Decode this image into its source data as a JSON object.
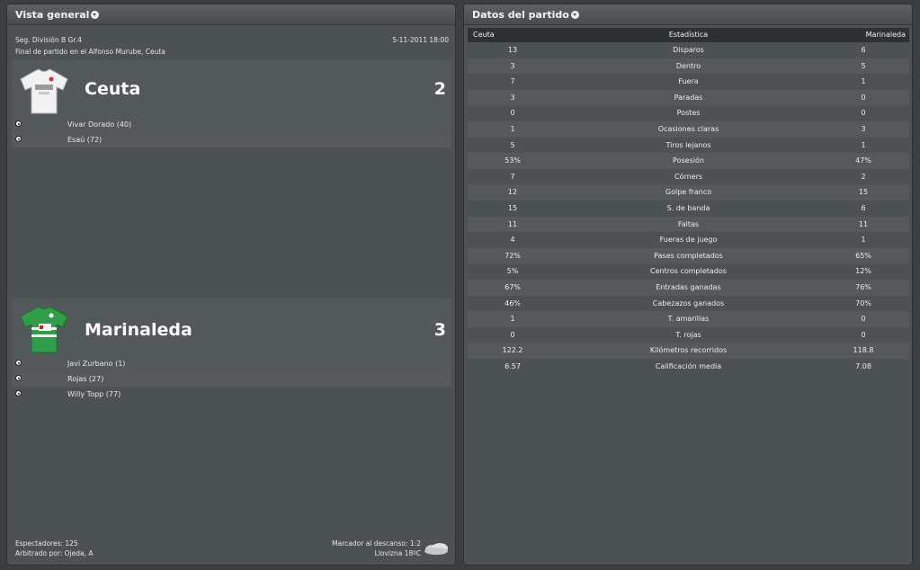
{
  "overview": {
    "title": "Vista general",
    "competition": "Seg. División B Gr.4",
    "date": "5-11-2011 18:00",
    "venue_line": "Final de partido en el Alfonso Murube, Ceuta",
    "home": {
      "name": "Ceuta",
      "score": "2",
      "kit_icon": "white-shirt-icon",
      "scorers": [
        "Vivar Dorado (40)",
        "Esaú (72)"
      ]
    },
    "away": {
      "name": "Marinaleda",
      "score": "3",
      "kit_icon": "green-shirt-icon",
      "scorers": [
        "Javi Zurbano (1)",
        "Rojas (27)",
        "Willy Topp (77)"
      ]
    },
    "attendance": "Espectadores: 125",
    "referee": "Arbitrado por: Ojeda, A",
    "halftime": "Marcador al descanso: 1:2",
    "weather": "Llovizna 18ºC",
    "weather_icon": "cloud-rain-icon"
  },
  "stats": {
    "title": "Datos del partido",
    "header": {
      "home": "Ceuta",
      "stat": "Estadística",
      "away": "Marinaleda"
    },
    "rows": [
      {
        "home": "13",
        "stat": "Disparos",
        "away": "6"
      },
      {
        "home": "3",
        "stat": "Dentro",
        "away": "5"
      },
      {
        "home": "7",
        "stat": "Fuera",
        "away": "1"
      },
      {
        "home": "3",
        "stat": "Paradas",
        "away": "0"
      },
      {
        "home": "0",
        "stat": "Postes",
        "away": "0"
      },
      {
        "home": "1",
        "stat": "Ocasiones claras",
        "away": "3"
      },
      {
        "home": "5",
        "stat": "Tiros lejanos",
        "away": "1"
      },
      {
        "home": "53%",
        "stat": "Posesión",
        "away": "47%"
      },
      {
        "home": "7",
        "stat": "Córners",
        "away": "2"
      },
      {
        "home": "12",
        "stat": "Golpe franco",
        "away": "15"
      },
      {
        "home": "15",
        "stat": "S. de banda",
        "away": "6"
      },
      {
        "home": "11",
        "stat": "Faltas",
        "away": "11"
      },
      {
        "home": "4",
        "stat": "Fueras de juego",
        "away": "1"
      },
      {
        "home": "72%",
        "stat": "Pases completados",
        "away": "65%"
      },
      {
        "home": "5%",
        "stat": "Centros completados",
        "away": "12%"
      },
      {
        "home": "67%",
        "stat": "Entradas ganadas",
        "away": "76%"
      },
      {
        "home": "46%",
        "stat": "Cabezazos ganados",
        "away": "70%"
      },
      {
        "home": "1",
        "stat": "T. amarillas",
        "away": "0"
      },
      {
        "home": "0",
        "stat": "T. rojas",
        "away": "0"
      },
      {
        "home": "122.2",
        "stat": "Kilómetros recorridos",
        "away": "118.8"
      },
      {
        "home": "6.57",
        "stat": "Calificación media",
        "away": "7.08"
      }
    ]
  },
  "colors": {
    "background": "#3b3f42",
    "panel": "#4c5154",
    "row_alt": "#55595c",
    "header_bar": "#2e3134",
    "home_kit": "#f2f2f2",
    "away_kit": "#2e9e48"
  }
}
